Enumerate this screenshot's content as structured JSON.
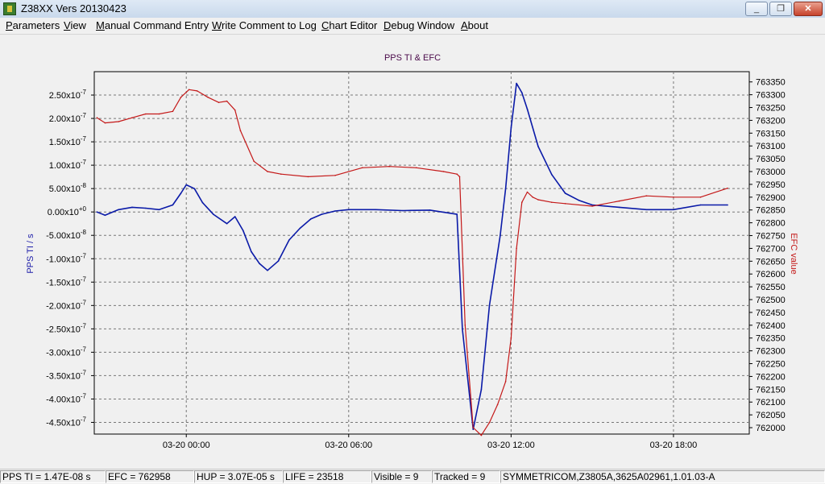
{
  "window": {
    "title": "Z38XX Vers 20130423",
    "minimize_symbol": "_",
    "maximize_symbol": "❐",
    "close_symbol": "✕"
  },
  "menu": [
    {
      "label": "Parameters",
      "accel": "P",
      "rest": "arameters"
    },
    {
      "label": "View",
      "accel": "V",
      "rest": "iew"
    },
    {
      "label": "Manual Command Entry",
      "accel": "M",
      "rest": "anual Command Entry"
    },
    {
      "label": "Write Comment to Log",
      "accel": "W",
      "rest": "rite Comment to Log"
    },
    {
      "label": "Chart Editor",
      "accel": "C",
      "rest": "hart Editor"
    },
    {
      "label": "Debug Window",
      "accel": "D",
      "rest": "ebug Window"
    },
    {
      "label": "About",
      "accel": "A",
      "rest": "bout"
    }
  ],
  "chart_data": {
    "type": "line",
    "title": "PPS TI & EFC",
    "ylabel": "PPS TI / s",
    "y2label": "EFC value",
    "x_tick_labels": [
      "03-20 00:00",
      "03-20 06:00",
      "03-20 12:00",
      "03-20 18:00"
    ],
    "x_ticks_hours": [
      0,
      6,
      12,
      18
    ],
    "xlim_hours": [
      -3.4,
      20.8
    ],
    "ylim": [
      -4.75e-07,
      3e-07
    ],
    "y_ticks": [
      {
        "value": 2.5e-07,
        "mant": "2.50x10",
        "exp": "-7"
      },
      {
        "value": 2e-07,
        "mant": "2.00x10",
        "exp": "-7"
      },
      {
        "value": 1.5e-07,
        "mant": "1.50x10",
        "exp": "-7"
      },
      {
        "value": 1e-07,
        "mant": "1.00x10",
        "exp": "-7"
      },
      {
        "value": 5e-08,
        "mant": "5.00x10",
        "exp": "-8"
      },
      {
        "value": 0,
        "mant": "0.00x10",
        "exp": "+0"
      },
      {
        "value": -5e-08,
        "mant": "-5.00x10",
        "exp": "-8"
      },
      {
        "value": -1e-07,
        "mant": "-1.00x10",
        "exp": "-7"
      },
      {
        "value": -1.5e-07,
        "mant": "-1.50x10",
        "exp": "-7"
      },
      {
        "value": -2e-07,
        "mant": "-2.00x10",
        "exp": "-7"
      },
      {
        "value": -2.5e-07,
        "mant": "-2.50x10",
        "exp": "-7"
      },
      {
        "value": -3e-07,
        "mant": "-3.00x10",
        "exp": "-7"
      },
      {
        "value": -3.5e-07,
        "mant": "-3.50x10",
        "exp": "-7"
      },
      {
        "value": -4e-07,
        "mant": "-4.00x10",
        "exp": "-7"
      },
      {
        "value": -4.5e-07,
        "mant": "-4.50x10",
        "exp": "-7"
      }
    ],
    "y2lim": [
      761975,
      763390
    ],
    "y2_ticks": [
      763350,
      763300,
      763250,
      763200,
      763150,
      763100,
      763050,
      763000,
      762950,
      762900,
      762850,
      762800,
      762750,
      762700,
      762650,
      762600,
      762550,
      762500,
      762450,
      762400,
      762350,
      762300,
      762250,
      762200,
      762150,
      762100,
      762050,
      762000
    ],
    "grid": true,
    "series": [
      {
        "axis": "left",
        "color": "#0a1aa8",
        "x": [
          -3.3,
          -3.0,
          -2.5,
          -2.0,
          -1.5,
          -1.0,
          -0.5,
          -0.2,
          0.0,
          0.3,
          0.6,
          1.0,
          1.5,
          1.8,
          2.1,
          2.4,
          2.7,
          3.0,
          3.4,
          3.8,
          4.2,
          4.6,
          5.0,
          5.5,
          6.0,
          7.0,
          8.0,
          9.0,
          10.0,
          10.2,
          10.6,
          10.9,
          11.2,
          11.6,
          11.8,
          12.0,
          12.2,
          12.4,
          12.6,
          13.0,
          13.5,
          14.0,
          14.5,
          15.0,
          16.0,
          17.0,
          18.0,
          19.0,
          20.0
        ],
        "y": [
          0.0,
          -7e-09,
          5e-09,
          1e-08,
          8e-09,
          5e-09,
          1.5e-08,
          4e-08,
          5.8e-08,
          5e-08,
          2e-08,
          -5e-09,
          -2.5e-08,
          -1e-08,
          -4e-08,
          -8.5e-08,
          -1.1e-07,
          -1.25e-07,
          -1.05e-07,
          -6e-08,
          -3.5e-08,
          -1.5e-08,
          -5e-09,
          2e-09,
          5e-09,
          5e-09,
          3e-09,
          4e-09,
          -5e-09,
          -2.5e-07,
          -4.65e-07,
          -3.8e-07,
          -2e-07,
          -5e-08,
          5e-08,
          1.8e-07,
          2.75e-07,
          2.55e-07,
          2.2e-07,
          1.4e-07,
          8e-08,
          4e-08,
          2.5e-08,
          1.5e-08,
          1e-08,
          5e-09,
          5e-09,
          1.5e-08,
          1.5e-08
        ]
      },
      {
        "axis": "right",
        "color": "#c41818",
        "x": [
          -3.3,
          -3.0,
          -2.5,
          -2.0,
          -1.5,
          -1.0,
          -0.5,
          -0.2,
          0.1,
          0.4,
          0.8,
          1.2,
          1.5,
          1.8,
          2.0,
          2.5,
          3.0,
          3.5,
          4.5,
          5.5,
          6.5,
          7.5,
          8.5,
          9.5,
          10.0,
          10.1,
          10.3,
          10.6,
          10.9,
          11.2,
          11.5,
          11.8,
          12.0,
          12.2,
          12.4,
          12.6,
          12.8,
          13.0,
          13.5,
          14.0,
          15.0,
          16.0,
          17.0,
          18.0,
          19.0,
          20.0
        ],
        "y": [
          763210,
          763190,
          763195,
          763210,
          763225,
          763225,
          763235,
          763290,
          763320,
          763315,
          763290,
          763270,
          763275,
          763240,
          763160,
          763040,
          763000,
          762990,
          762980,
          762985,
          763015,
          763020,
          763015,
          763000,
          762990,
          762980,
          762400,
          762000,
          761970,
          762020,
          762090,
          762180,
          762350,
          762700,
          762880,
          762920,
          762900,
          762890,
          762880,
          762875,
          762865,
          762885,
          762905,
          762900,
          762900,
          762935
        ]
      }
    ]
  },
  "status": [
    {
      "text": "PPS TI = 1.47E-08 s"
    },
    {
      "text": "EFC = 762958"
    },
    {
      "text": "HUP = 3.07E-05 s"
    },
    {
      "text": "LIFE = 23518"
    },
    {
      "text": "Visible = 9"
    },
    {
      "text": "Tracked = 9"
    },
    {
      "text": "SYMMETRICOM,Z3805A,3625A02961,1.01.03-A"
    }
  ]
}
